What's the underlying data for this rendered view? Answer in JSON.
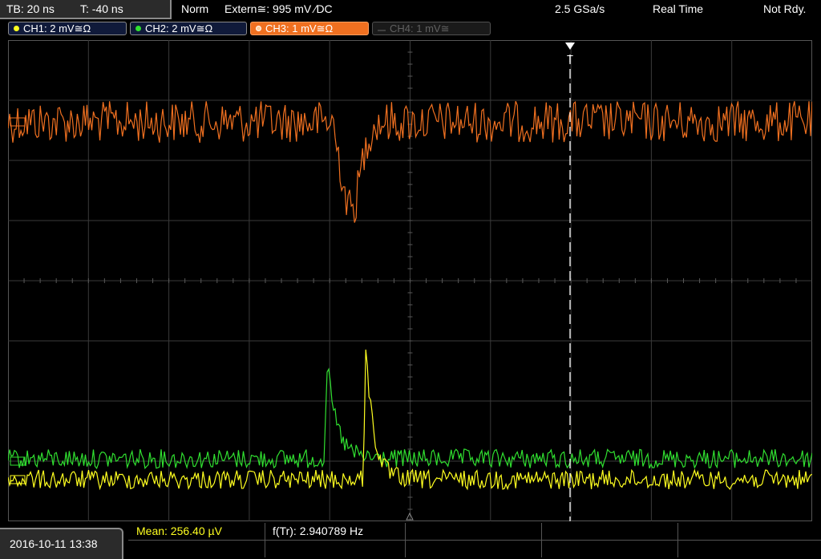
{
  "header": {
    "timebase": "TB: 20 ns",
    "trigger_time": "T: -40 ns",
    "trigger_mode": "Norm",
    "trigger_source": "Extern≅: 995 mV ∕DC",
    "sample_rate": "2.5 GSa/s",
    "acquisition": "Real Time",
    "status": "Not Rdy."
  },
  "channels": [
    {
      "label": "CH1: 2 mV≅Ω",
      "color": "#ffff20",
      "active": true
    },
    {
      "label": "CH2: 2 mV≅Ω",
      "color": "#30e030",
      "active": true
    },
    {
      "label": "CH3: 1 mV≅Ω",
      "color": "#f07020",
      "active": true
    },
    {
      "label": "CH4: 1 mV≅",
      "color": "#606060",
      "active": false
    }
  ],
  "trigger_marker": "T",
  "bottom": {
    "datetime": "2016-10-11 13:38",
    "mean": "Mean: 256.40 µV",
    "frequency": "f(Tr): 2.940789 Hz"
  },
  "colors": {
    "ch1": "#ffff20",
    "ch2": "#30e030",
    "ch3": "#f07020",
    "grid": "#3a3a3a"
  }
}
